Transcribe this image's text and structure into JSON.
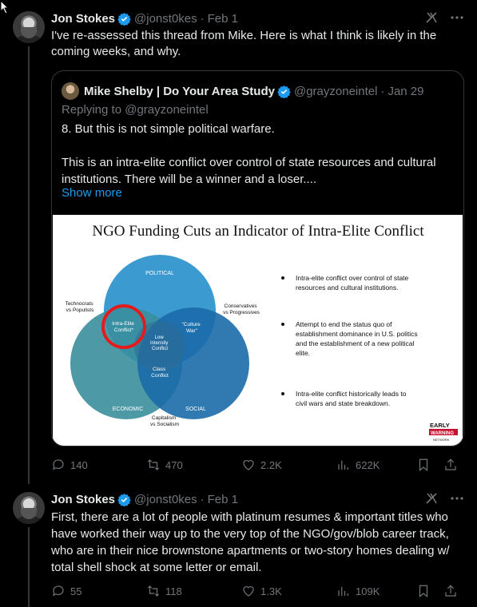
{
  "colors": {
    "background": "#000000",
    "text": "#e7e9ea",
    "muted": "#71767b",
    "link": "#1d9bf0",
    "verified": "#1d9bf0",
    "border": "#333639"
  },
  "tweet1": {
    "name": "Jon Stokes",
    "handle": "@jonst0kes",
    "dot": "·",
    "date": "Feb 1",
    "text": "I've re-assessed this thread from Mike. Here is what I think is likely in the coming weeks, and why.",
    "quote": {
      "name": "Mike Shelby | Do Your Area Study",
      "handle": "@grayzoneintel",
      "dot": "·",
      "date": "Jan 29",
      "replying": "Replying to @grayzoneintel",
      "text1": "8. But this is not simple political warfare.",
      "text2": "This is an intra-elite conflict over control of state resources and cultural institutions. There will be a winner and a loser....",
      "show_more": "Show more",
      "image": {
        "title": "NGO Funding Cuts an Indicator of Intra-Elite Conflict",
        "circles": {
          "top": "POLITICAL",
          "left": "ECONOMIC",
          "right": "SOCIAL"
        },
        "labels": {
          "technocrats": [
            "Technocrats",
            "vs Populists"
          ],
          "conservatives": [
            "Conservatives",
            "vs Progressives"
          ],
          "capitalism": [
            "Capitalism",
            "vs Socialism"
          ],
          "intra_elite": [
            "Intra-Elite",
            "Conflict*"
          ],
          "culture_war": [
            "\"Culture",
            "War\""
          ],
          "low_intensity": [
            "Low",
            "Intensity",
            "Conflict"
          ],
          "class_conflict": [
            "Class",
            "Conflict"
          ]
        },
        "bullets": [
          [
            "Intra-elite conflict over control of state",
            "resources and cultural institutions."
          ],
          [
            "Attempt to end the status quo of",
            "establishment dominance in U.S. politics",
            "and the establishment of a new political",
            "elite."
          ],
          [
            "Intra-elite conflict historically leads to",
            "civil wars and state breakdown."
          ]
        ],
        "logo": [
          "EARLY",
          "WARNING",
          "NETWORK"
        ]
      }
    },
    "actions": {
      "replies": "140",
      "reposts": "470",
      "likes": "2.2K",
      "views": "622K"
    }
  },
  "tweet2": {
    "name": "Jon Stokes",
    "handle": "@jonst0kes",
    "dot": "·",
    "date": "Feb 1",
    "text": "First, there are a lot of people with platinum resumes & important titles who have worked their way up to the very top of the NGO/gov/blob career track, who are in their nice brownstone apartments or two-story homes dealing w/ total shell shock at some letter or email.",
    "actions": {
      "replies": "55",
      "reposts": "118",
      "likes": "1.3K",
      "views": "109K"
    }
  }
}
